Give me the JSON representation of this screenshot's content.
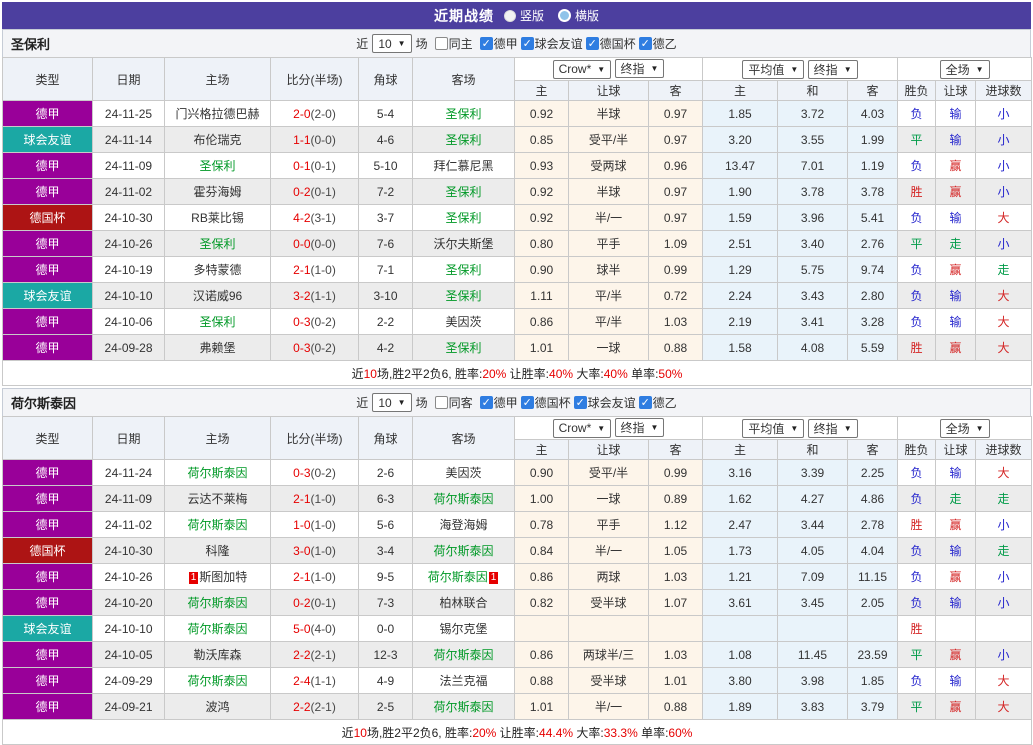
{
  "page": {
    "title": "近期战绩",
    "view_options": [
      {
        "label": "竖版",
        "selected": true
      },
      {
        "label": "横版",
        "selected": false
      }
    ]
  },
  "selects": {
    "company": "Crow*",
    "final_index": "终指",
    "average": "平均值",
    "final_index2": "终指",
    "scope": "全场"
  },
  "column_headers": {
    "type": "类型",
    "date": "日期",
    "home": "主场",
    "score": "比分(半场)",
    "corner": "角球",
    "away": "客场",
    "odds_home": "主",
    "odds_handicap": "让球",
    "odds_away": "客",
    "avg_home": "主",
    "avg_draw": "和",
    "avg_away": "客",
    "result_wdl": "胜负",
    "result_handicap": "让球",
    "result_goals": "进球数"
  },
  "colors": {
    "topbar_bg": "#4c3f9f",
    "highlight_team": "#009926",
    "score_red": "#e60000",
    "crow_col_bg": "#fdf5ea",
    "avg_col_bg": "#e9f3fa"
  },
  "type_colors": {
    "德甲": "#990099",
    "球会友谊": "#1ba8a4",
    "德国杯": "#ad1414",
    "德乙": "#888888"
  },
  "result_colors": {
    "胜": "#d42424",
    "平": "#009b48",
    "负": "#2525cd",
    "赢": "#d42424",
    "走": "#009b48",
    "输": "#2525cd",
    "大": "#d42424",
    "小": "#2525cd"
  },
  "tables": [
    {
      "team": "圣保利",
      "filters": {
        "near": "近",
        "count": "10",
        "unit": "场",
        "same": {
          "label": "同主",
          "checked": false
        },
        "leagues": [
          {
            "label": "德甲",
            "checked": true
          },
          {
            "label": "球会友谊",
            "checked": true
          },
          {
            "label": "德国杯",
            "checked": true
          },
          {
            "label": "德乙",
            "checked": true
          }
        ]
      },
      "rows": [
        {
          "type": "德甲",
          "date": "24-11-25",
          "home": {
            "name": "门兴格拉德巴赫"
          },
          "score": "2-0",
          "half": "(2-0)",
          "corner": "5-4",
          "away": {
            "name": "圣保利",
            "hl": true
          },
          "odds": [
            "0.92",
            "半球",
            "0.97"
          ],
          "avg": [
            "1.85",
            "3.72",
            "4.03"
          ],
          "results": [
            "负",
            "输",
            "小"
          ]
        },
        {
          "type": "球会友谊",
          "date": "24-11-14",
          "home": {
            "name": "布伦瑞克"
          },
          "score": "1-1",
          "half": "(0-0)",
          "corner": "4-6",
          "away": {
            "name": "圣保利",
            "hl": true
          },
          "odds": [
            "0.85",
            "受平/半",
            "0.97"
          ],
          "avg": [
            "3.20",
            "3.55",
            "1.99"
          ],
          "results": [
            "平",
            "输",
            "小"
          ]
        },
        {
          "type": "德甲",
          "date": "24-11-09",
          "home": {
            "name": "圣保利",
            "hl": true
          },
          "score": "0-1",
          "half": "(0-1)",
          "corner": "5-10",
          "away": {
            "name": "拜仁慕尼黑"
          },
          "odds": [
            "0.93",
            "受两球",
            "0.96"
          ],
          "avg": [
            "13.47",
            "7.01",
            "1.19"
          ],
          "results": [
            "负",
            "赢",
            "小"
          ]
        },
        {
          "type": "德甲",
          "date": "24-11-02",
          "home": {
            "name": "霍芬海姆"
          },
          "score": "0-2",
          "half": "(0-1)",
          "corner": "7-2",
          "away": {
            "name": "圣保利",
            "hl": true
          },
          "odds": [
            "0.92",
            "半球",
            "0.97"
          ],
          "avg": [
            "1.90",
            "3.78",
            "3.78"
          ],
          "results": [
            "胜",
            "赢",
            "小"
          ]
        },
        {
          "type": "德国杯",
          "date": "24-10-30",
          "home": {
            "name": "RB莱比锡"
          },
          "score": "4-2",
          "half": "(3-1)",
          "corner": "3-7",
          "away": {
            "name": "圣保利",
            "hl": true
          },
          "odds": [
            "0.92",
            "半/一",
            "0.97"
          ],
          "avg": [
            "1.59",
            "3.96",
            "5.41"
          ],
          "results": [
            "负",
            "输",
            "大"
          ]
        },
        {
          "type": "德甲",
          "date": "24-10-26",
          "home": {
            "name": "圣保利",
            "hl": true
          },
          "score": "0-0",
          "half": "(0-0)",
          "corner": "7-6",
          "away": {
            "name": "沃尔夫斯堡"
          },
          "odds": [
            "0.80",
            "平手",
            "1.09"
          ],
          "avg": [
            "2.51",
            "3.40",
            "2.76"
          ],
          "results": [
            "平",
            "走",
            "小"
          ]
        },
        {
          "type": "德甲",
          "date": "24-10-19",
          "home": {
            "name": "多特蒙德"
          },
          "score": "2-1",
          "half": "(1-0)",
          "corner": "7-1",
          "away": {
            "name": "圣保利",
            "hl": true
          },
          "odds": [
            "0.90",
            "球半",
            "0.99"
          ],
          "avg": [
            "1.29",
            "5.75",
            "9.74"
          ],
          "results": [
            "负",
            "赢",
            "走"
          ]
        },
        {
          "type": "球会友谊",
          "date": "24-10-10",
          "home": {
            "name": "汉诺威96"
          },
          "score": "3-2",
          "half": "(1-1)",
          "corner": "3-10",
          "away": {
            "name": "圣保利",
            "hl": true
          },
          "odds": [
            "1.11",
            "平/半",
            "0.72"
          ],
          "avg": [
            "2.24",
            "3.43",
            "2.80"
          ],
          "results": [
            "负",
            "输",
            "大"
          ]
        },
        {
          "type": "德甲",
          "date": "24-10-06",
          "home": {
            "name": "圣保利",
            "hl": true
          },
          "score": "0-3",
          "half": "(0-2)",
          "corner": "2-2",
          "away": {
            "name": "美因茨"
          },
          "odds": [
            "0.86",
            "平/半",
            "1.03"
          ],
          "avg": [
            "2.19",
            "3.41",
            "3.28"
          ],
          "results": [
            "负",
            "输",
            "大"
          ]
        },
        {
          "type": "德甲",
          "date": "24-09-28",
          "home": {
            "name": "弗赖堡"
          },
          "score": "0-3",
          "half": "(0-2)",
          "corner": "4-2",
          "away": {
            "name": "圣保利",
            "hl": true
          },
          "odds": [
            "1.01",
            "一球",
            "0.88"
          ],
          "avg": [
            "1.58",
            "4.08",
            "5.59"
          ],
          "results": [
            "胜",
            "赢",
            "大"
          ]
        }
      ],
      "summary": [
        {
          "t": "近"
        },
        {
          "t": "10",
          "red": true
        },
        {
          "t": "场,胜2平2负6, 胜率:"
        },
        {
          "t": "20%",
          "red": true
        },
        {
          "t": " 让胜率:"
        },
        {
          "t": "40%",
          "red": true
        },
        {
          "t": " 大率:"
        },
        {
          "t": "40%",
          "red": true
        },
        {
          "t": " 单率:"
        },
        {
          "t": "50%",
          "red": true
        }
      ]
    },
    {
      "team": "荷尔斯泰因",
      "filters": {
        "near": "近",
        "count": "10",
        "unit": "场",
        "same": {
          "label": "同客",
          "checked": false
        },
        "leagues": [
          {
            "label": "德甲",
            "checked": true
          },
          {
            "label": "德国杯",
            "checked": true
          },
          {
            "label": "球会友谊",
            "checked": true
          },
          {
            "label": "德乙",
            "checked": true
          }
        ]
      },
      "rows": [
        {
          "type": "德甲",
          "date": "24-11-24",
          "home": {
            "name": "荷尔斯泰因",
            "hl": true
          },
          "score": "0-3",
          "half": "(0-2)",
          "corner": "2-6",
          "away": {
            "name": "美因茨"
          },
          "odds": [
            "0.90",
            "受平/半",
            "0.99"
          ],
          "avg": [
            "3.16",
            "3.39",
            "2.25"
          ],
          "results": [
            "负",
            "输",
            "大"
          ]
        },
        {
          "type": "德甲",
          "date": "24-11-09",
          "home": {
            "name": "云达不莱梅"
          },
          "score": "2-1",
          "half": "(1-0)",
          "corner": "6-3",
          "away": {
            "name": "荷尔斯泰因",
            "hl": true
          },
          "odds": [
            "1.00",
            "一球",
            "0.89"
          ],
          "avg": [
            "1.62",
            "4.27",
            "4.86"
          ],
          "results": [
            "负",
            "走",
            "走"
          ]
        },
        {
          "type": "德甲",
          "date": "24-11-02",
          "home": {
            "name": "荷尔斯泰因",
            "hl": true
          },
          "score": "1-0",
          "half": "(1-0)",
          "corner": "5-6",
          "away": {
            "name": "海登海姆"
          },
          "odds": [
            "0.78",
            "平手",
            "1.12"
          ],
          "avg": [
            "2.47",
            "3.44",
            "2.78"
          ],
          "results": [
            "胜",
            "赢",
            "小"
          ]
        },
        {
          "type": "德国杯",
          "date": "24-10-30",
          "home": {
            "name": "科隆"
          },
          "score": "3-0",
          "half": "(1-0)",
          "corner": "3-4",
          "away": {
            "name": "荷尔斯泰因",
            "hl": true
          },
          "odds": [
            "0.84",
            "半/一",
            "1.05"
          ],
          "avg": [
            "1.73",
            "4.05",
            "4.04"
          ],
          "results": [
            "负",
            "输",
            "走"
          ]
        },
        {
          "type": "德甲",
          "date": "24-10-26",
          "home": {
            "name": "斯图加特",
            "card": "1"
          },
          "score": "2-1",
          "half": "(1-0)",
          "corner": "9-5",
          "away": {
            "name": "荷尔斯泰因",
            "hl": true,
            "card": "1"
          },
          "odds": [
            "0.86",
            "两球",
            "1.03"
          ],
          "avg": [
            "1.21",
            "7.09",
            "11.15"
          ],
          "results": [
            "负",
            "赢",
            "小"
          ]
        },
        {
          "type": "德甲",
          "date": "24-10-20",
          "home": {
            "name": "荷尔斯泰因",
            "hl": true
          },
          "score": "0-2",
          "half": "(0-1)",
          "corner": "7-3",
          "away": {
            "name": "柏林联合"
          },
          "odds": [
            "0.82",
            "受半球",
            "1.07"
          ],
          "avg": [
            "3.61",
            "3.45",
            "2.05"
          ],
          "results": [
            "负",
            "输",
            "小"
          ]
        },
        {
          "type": "球会友谊",
          "date": "24-10-10",
          "home": {
            "name": "荷尔斯泰因",
            "hl": true
          },
          "score": "5-0",
          "half": "(4-0)",
          "corner": "0-0",
          "away": {
            "name": "锡尔克堡"
          },
          "odds": [
            "",
            "",
            ""
          ],
          "avg": [
            "",
            "",
            ""
          ],
          "results": [
            "胜",
            "",
            ""
          ]
        },
        {
          "type": "德甲",
          "date": "24-10-05",
          "home": {
            "name": "勒沃库森"
          },
          "score": "2-2",
          "half": "(2-1)",
          "corner": "12-3",
          "away": {
            "name": "荷尔斯泰因",
            "hl": true
          },
          "odds": [
            "0.86",
            "两球半/三",
            "1.03"
          ],
          "avg": [
            "1.08",
            "11.45",
            "23.59"
          ],
          "results": [
            "平",
            "赢",
            "小"
          ]
        },
        {
          "type": "德甲",
          "date": "24-09-29",
          "home": {
            "name": "荷尔斯泰因",
            "hl": true
          },
          "score": "2-4",
          "half": "(1-1)",
          "corner": "4-9",
          "away": {
            "name": "法兰克福"
          },
          "odds": [
            "0.88",
            "受半球",
            "1.01"
          ],
          "avg": [
            "3.80",
            "3.98",
            "1.85"
          ],
          "results": [
            "负",
            "输",
            "大"
          ]
        },
        {
          "type": "德甲",
          "date": "24-09-21",
          "home": {
            "name": "波鸿"
          },
          "score": "2-2",
          "half": "(2-1)",
          "corner": "2-5",
          "away": {
            "name": "荷尔斯泰因",
            "hl": true
          },
          "odds": [
            "1.01",
            "半/一",
            "0.88"
          ],
          "avg": [
            "1.89",
            "3.83",
            "3.79"
          ],
          "results": [
            "平",
            "赢",
            "大"
          ]
        }
      ],
      "summary": [
        {
          "t": "近"
        },
        {
          "t": "10",
          "red": true
        },
        {
          "t": "场,胜2平2负6, 胜率:"
        },
        {
          "t": "20%",
          "red": true
        },
        {
          "t": " 让胜率:"
        },
        {
          "t": "44.4%",
          "red": true
        },
        {
          "t": " 大率:"
        },
        {
          "t": "33.3%",
          "red": true
        },
        {
          "t": " 单率:"
        },
        {
          "t": "60%",
          "red": true
        }
      ]
    }
  ]
}
